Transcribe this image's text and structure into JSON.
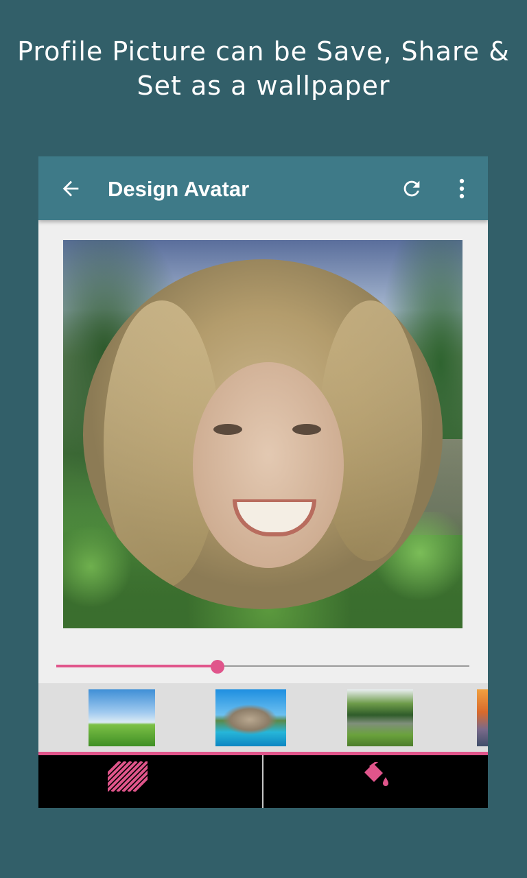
{
  "promo": {
    "line1": "Profile Picture can be Save, Share &",
    "line2": "Set as a wallpaper"
  },
  "toolbar": {
    "back_icon": "arrow-left-icon",
    "title": "Design Avatar",
    "refresh_icon": "refresh-icon",
    "more_icon": "more-vert-icon"
  },
  "editor": {
    "opacity_slider_value": 0.39
  },
  "backgrounds": [
    {
      "name": "green-field"
    },
    {
      "name": "rocks-beach"
    },
    {
      "name": "forest-lake"
    },
    {
      "name": "sunset"
    }
  ],
  "bottom_bar": {
    "left_icon": "pattern-icon",
    "right_icon": "paint-bucket-icon"
  },
  "colors": {
    "background": "#325f69",
    "toolbar": "#3e7a88",
    "accent": "#e0558b",
    "bottom_bar": "#000000"
  }
}
